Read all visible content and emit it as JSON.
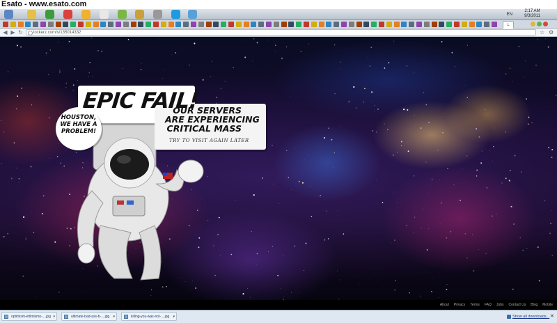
{
  "watermark": {
    "text": "Esato - www.esato.com"
  },
  "taskbar": {
    "apps": [
      {
        "name": "explorer-app-icon",
        "color": "#5b86c2"
      },
      {
        "name": "folder-app-icon",
        "color": "#e3c04a"
      },
      {
        "name": "utorrent-app-icon",
        "color": "#3c9b3c"
      },
      {
        "name": "chrome-app-icon",
        "color": "#d9413a"
      },
      {
        "name": "messenger-app-icon",
        "color": "#f0b030"
      },
      {
        "name": "talk-app-icon",
        "color": "#e8e8e8"
      },
      {
        "name": "network-app-icon",
        "color": "#7ab648"
      },
      {
        "name": "winamp-app-icon",
        "color": "#c8a040"
      },
      {
        "name": "media-app-icon",
        "color": "#999999"
      },
      {
        "name": "skype-app-icon",
        "color": "#1e9be0"
      },
      {
        "name": "paint-app-icon",
        "color": "#5aa0d8"
      }
    ],
    "tray_lang": "EN",
    "clock": {
      "time": "2:17 AM",
      "date": "9/3/2011"
    }
  },
  "url": "lockerz.com/s/135014332",
  "page": {
    "headline": "EPIC FAIL!",
    "servers_lines": [
      "OUR SERVERS",
      "ARE EXPERIENCING",
      "CRITICAL MASS"
    ],
    "try_again": "TRY TO VISIT AGAIN LATER",
    "houston_lines": [
      "HOUSTON,",
      "WE HAVE A",
      "PROBLEM!"
    ]
  },
  "footer": {
    "links": [
      "About",
      "Privacy",
      "Terms",
      "FAQ",
      "Jobs",
      "Contact Us",
      "Blog",
      "Mobile"
    ]
  },
  "downloads": {
    "items": [
      "optimism-ettimismo-....jpg",
      "ultimate-bad-ass-b-....jpg",
      "killing-you-was-not-....jpg"
    ],
    "show_all": "Show all downloads..."
  }
}
